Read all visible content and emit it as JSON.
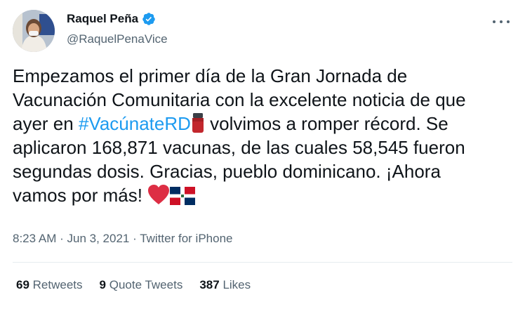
{
  "author": {
    "display_name": "Raquel Peña",
    "handle": "@RaquelPenaVice",
    "verified": true
  },
  "tweet": {
    "lines": [
      [
        {
          "text": "Empezamos el primer día de la Gran Jornada de"
        }
      ],
      [
        {
          "text": "Vacunación Comunitaria con la excelente noticia de que"
        }
      ],
      [
        {
          "text": "ayer en "
        },
        {
          "hashtag": "#VacúnateRD"
        },
        {
          "emoji": "vaccine-vial-emoji"
        },
        {
          "text": " volvimos a romper récord. Se"
        }
      ],
      [
        {
          "text": "aplicaron 168,871 vacunas, de las cuales 58,545 fueron"
        }
      ],
      [
        {
          "text": "segundas dosis. Gracias, pueblo dominicano. ¡Ahora"
        }
      ],
      [
        {
          "text": "vamos por más! "
        },
        {
          "emoji": "red-heart-emoji"
        },
        {
          "emoji": "dominican-republic-flag-emoji"
        }
      ]
    ]
  },
  "meta": {
    "time": "8:23 AM",
    "date": "Jun 3, 2021",
    "source": "Twitter for iPhone",
    "separator": "·"
  },
  "stats": {
    "retweets": {
      "count": "69",
      "label": "Retweets"
    },
    "quote_tweets": {
      "count": "9",
      "label": "Quote Tweets"
    },
    "likes": {
      "count": "387",
      "label": "Likes"
    }
  },
  "colors": {
    "text": "#0f1419",
    "secondary": "#536471",
    "link": "#1d9bf0",
    "divider": "#e6ecf0",
    "heart": "#dd2e44"
  },
  "icons": [
    "verified-badge-icon",
    "more-options-icon"
  ]
}
